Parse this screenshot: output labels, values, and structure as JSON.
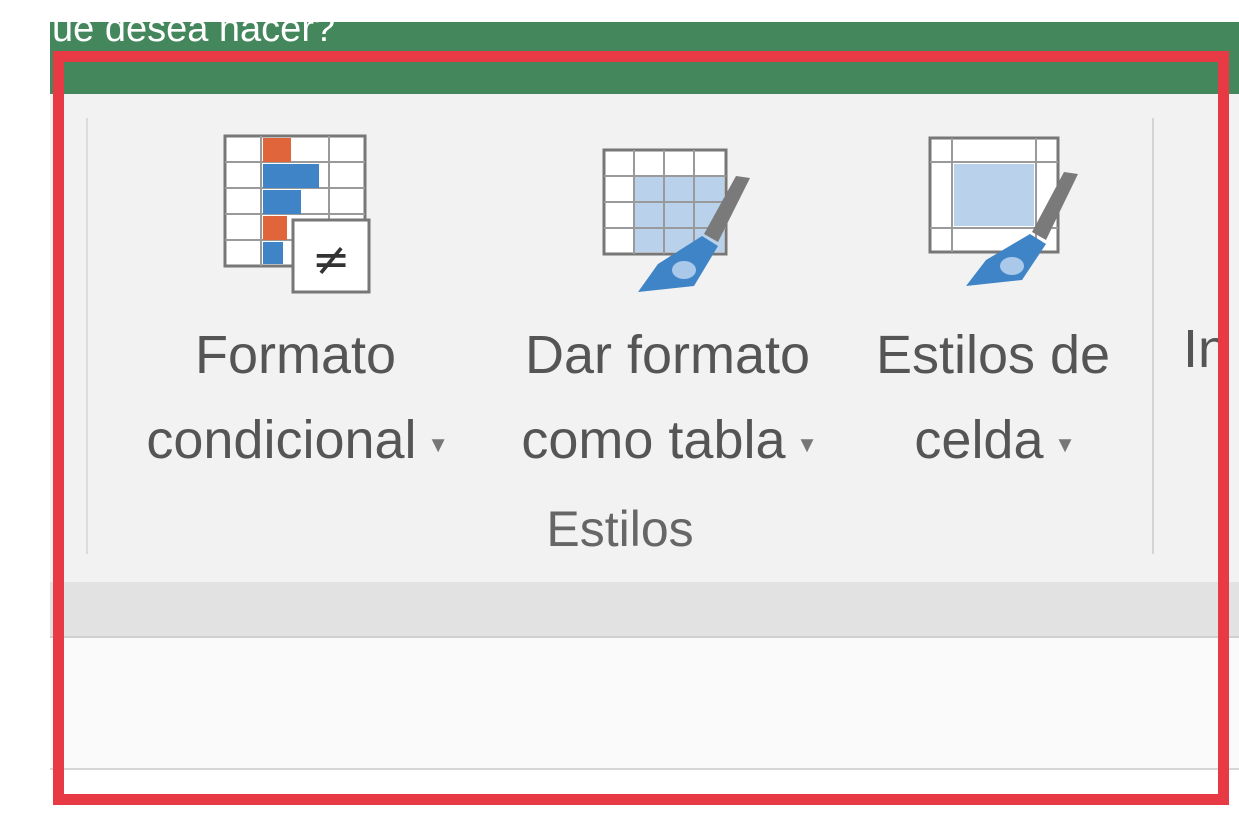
{
  "tell_me": {
    "text": "ue desea hacer?"
  },
  "ribbon": {
    "buttons": [
      {
        "line1": "Formato",
        "line2": "condicional",
        "icon": "conditional-formatting-icon"
      },
      {
        "line1": "Dar formato",
        "line2": "como tabla",
        "icon": "format-as-table-icon"
      },
      {
        "line1": "Estilos de",
        "line2": "celda",
        "icon": "cell-styles-icon"
      }
    ],
    "cut_off_label": "In",
    "group_label": "Estilos"
  },
  "colors": {
    "title_bar": "#44875d",
    "ribbon_bg": "#f2f2f2",
    "highlight_border": "#e83a44",
    "accent_orange": "#e0653a",
    "accent_blue": "#3f84c7"
  }
}
